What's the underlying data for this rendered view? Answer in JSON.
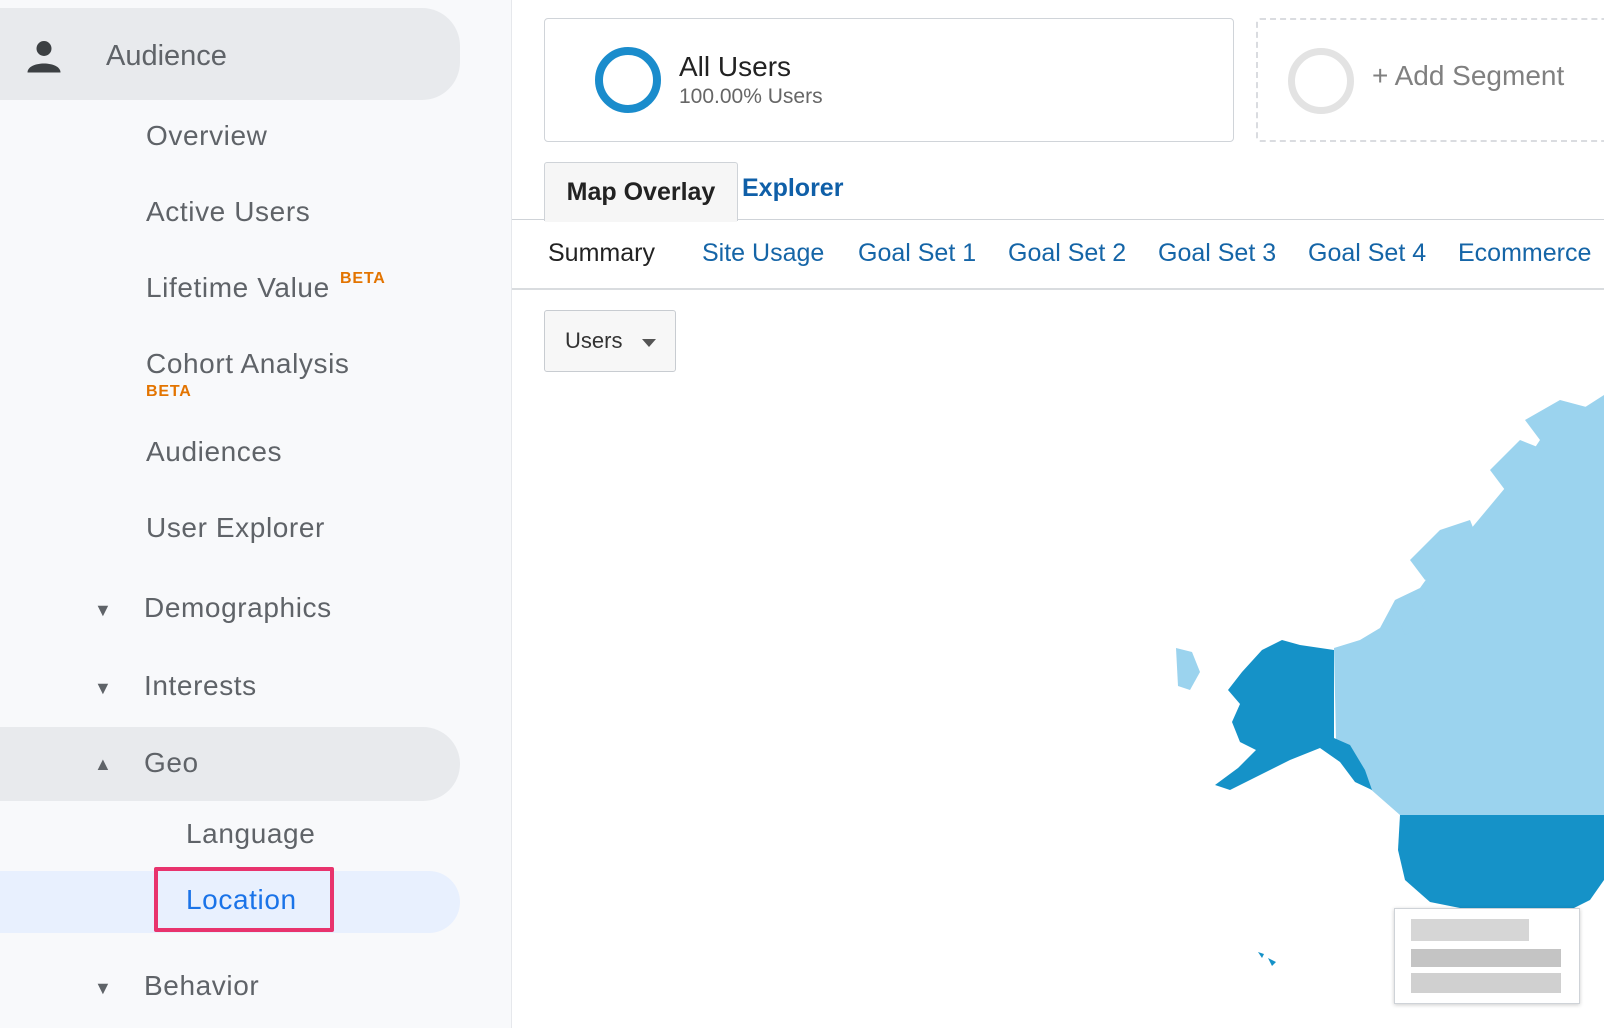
{
  "sidebar": {
    "audience": "Audience",
    "items": {
      "overview": "Overview",
      "active_users": "Active Users",
      "lifetime_value": "Lifetime Value",
      "cohort_analysis": "Cohort Analysis",
      "audiences": "Audiences",
      "user_explorer": "User Explorer"
    },
    "beta": "BETA",
    "groups": {
      "demographics": "Demographics",
      "interests": "Interests",
      "geo": "Geo",
      "behavior": "Behavior"
    },
    "geo_items": {
      "language": "Language",
      "location": "Location"
    }
  },
  "segments": {
    "all_users_title": "All Users",
    "all_users_sub": "100.00% Users",
    "add_segment": "+ Add Segment"
  },
  "tabs": {
    "map_overlay": "Map Overlay",
    "explorer": "Explorer"
  },
  "subtabs": {
    "summary": "Summary",
    "site_usage": "Site Usage",
    "goal_set_1": "Goal Set 1",
    "goal_set_2": "Goal Set 2",
    "goal_set_3": "Goal Set 3",
    "goal_set_4": "Goal Set 4",
    "ecommerce": "Ecommerce"
  },
  "metric_dropdown": {
    "selected": "Users"
  },
  "colors": {
    "accent_blue": "#1a73e8",
    "map_dark": "#1592c8",
    "map_light": "#9bd3ee",
    "highlight": "#e8336d",
    "beta": "#e37400"
  }
}
